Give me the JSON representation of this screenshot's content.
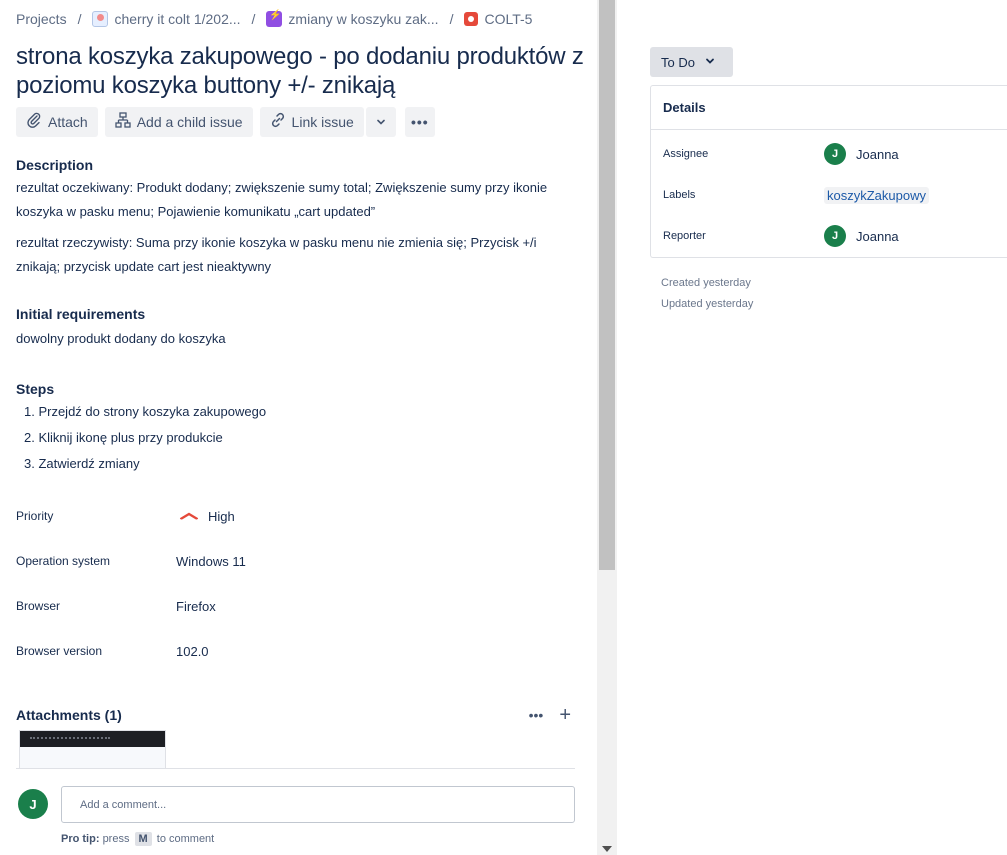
{
  "breadcrumb": {
    "projects": "Projects",
    "project": "cherry it colt 1/202...",
    "epic": "zmiany w koszyku zak...",
    "issue_key": "COLT-5"
  },
  "issue": {
    "title": "strona koszyka zakupowego - po dodaniu produktów z poziomu koszyka buttony +/- znikają"
  },
  "toolbar": {
    "attach": "Attach",
    "add_child": "Add a child issue",
    "link_issue": "Link issue",
    "more": "•••"
  },
  "description": {
    "label": "Description",
    "expected": "rezultat oczekiwany: Produkt dodany; zwiększenie sumy total; Zwiększenie sumy przy ikonie koszyka w pasku menu; Pojawienie komunikatu „cart updated”",
    "actual": "rezultat rzeczywisty: Suma przy ikonie koszyka w pasku menu nie zmienia się; Przycisk +/i znikają; przycisk update cart jest nieaktywny"
  },
  "initial_requirements": {
    "label": "Initial requirements",
    "text": "dowolny produkt dodany do koszyka"
  },
  "steps": {
    "label": "Steps",
    "items": [
      "1. Przejdź do strony koszyka zakupowego",
      "2. Kliknij ikonę plus przy produkcie",
      "3. Zatwierdź zmiany"
    ]
  },
  "fields": {
    "priority_label": "Priority",
    "priority_value": "High",
    "os_label": "Operation system",
    "os_value": "Windows 11",
    "browser_label": "Browser",
    "browser_value": "Firefox",
    "browser_version_label": "Browser version",
    "browser_version_value": "102.0"
  },
  "attachments": {
    "label": "Attachments (1)",
    "more": "•••",
    "add": "+"
  },
  "comment": {
    "avatar_initial": "J",
    "placeholder": "Add a comment...",
    "protip_bold": "Pro tip:",
    "protip_press": "press",
    "protip_key": "M",
    "protip_rest": "to comment"
  },
  "sidebar": {
    "status": "To Do",
    "details_title": "Details",
    "assignee_label": "Assignee",
    "assignee_initial": "J",
    "assignee_name": "Joanna",
    "labels_label": "Labels",
    "labels_value": "koszykZakupowy",
    "reporter_label": "Reporter",
    "reporter_initial": "J",
    "reporter_name": "Joanna",
    "created": "Created yesterday",
    "updated": "Updated yesterday"
  },
  "colors": {
    "accent": "#0c66e4",
    "avatar": "#1a7f4b",
    "priority_high": "#e5493a"
  }
}
